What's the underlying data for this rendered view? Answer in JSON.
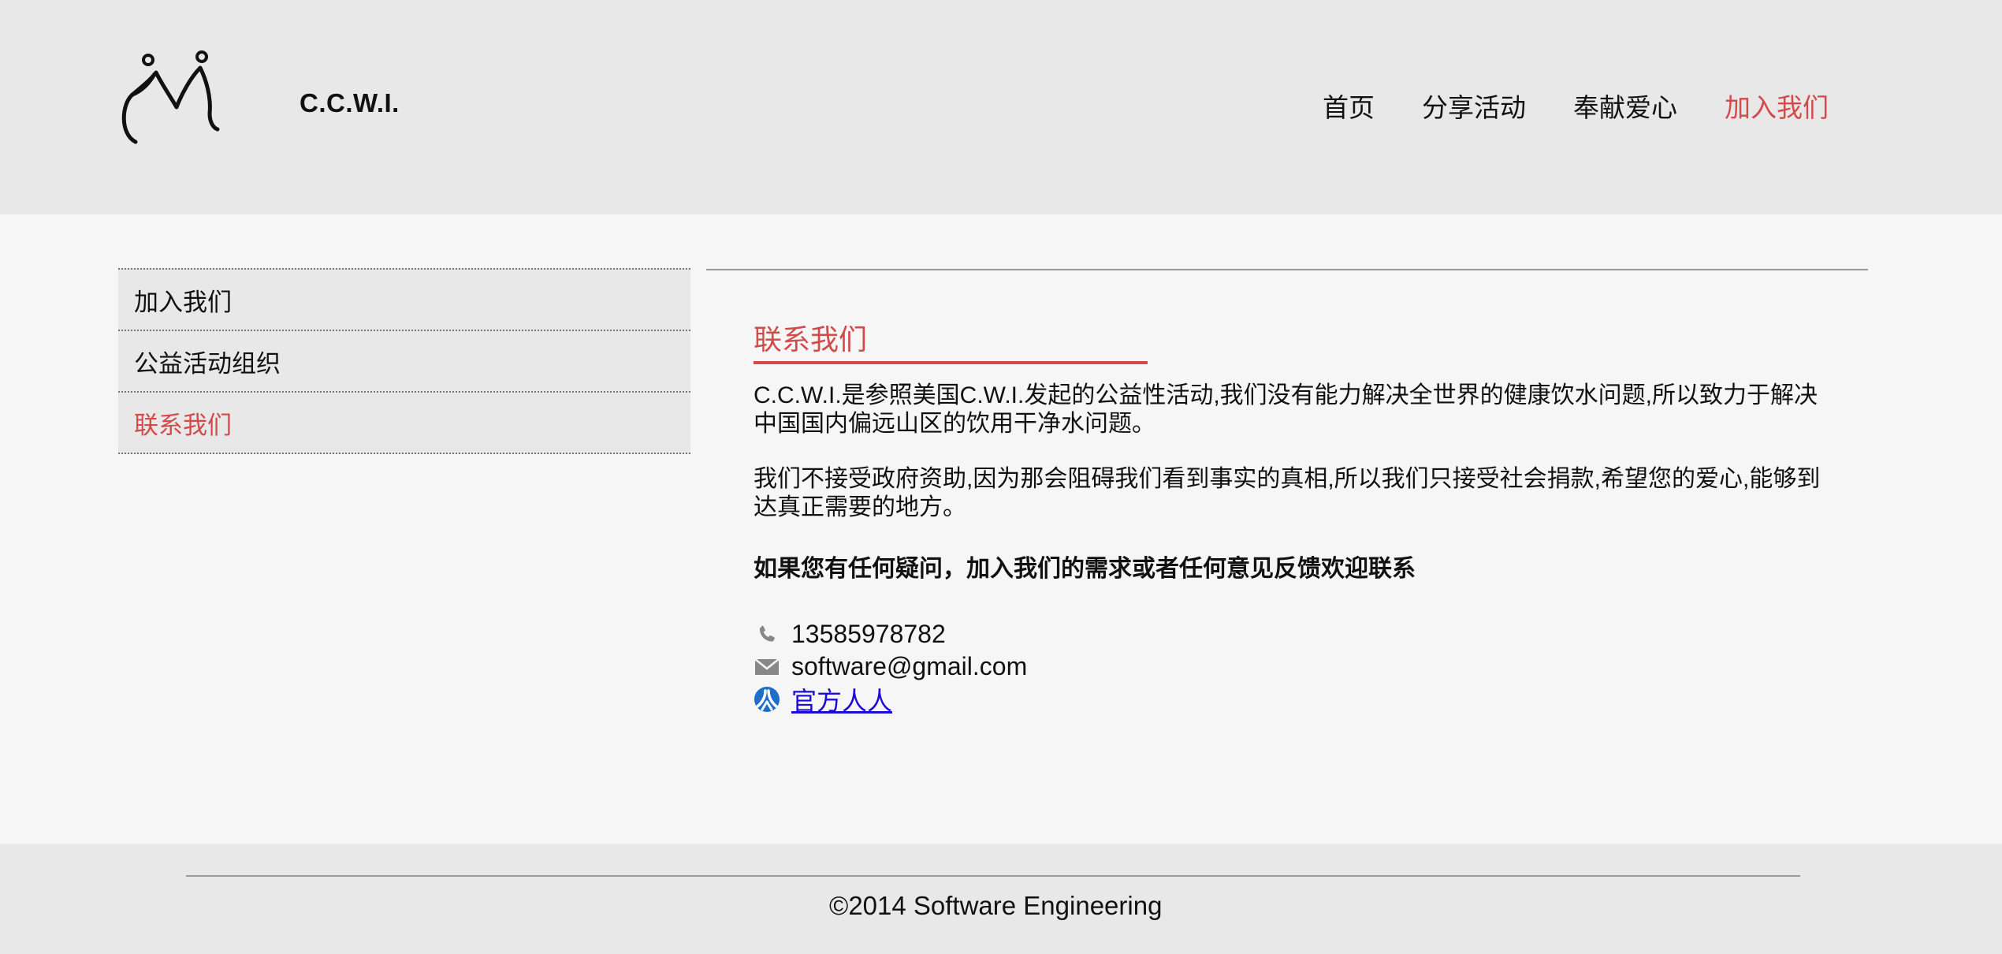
{
  "brand": {
    "name": "C.C.W.I."
  },
  "nav": {
    "items": [
      "首页",
      "分享活动",
      "奉献爱心",
      "加入我们"
    ],
    "active_color": "#d24a4a"
  },
  "sidebar": {
    "items": [
      "加入我们",
      "公益活动组织",
      "联系我们"
    ]
  },
  "main": {
    "title": "联系我们",
    "paragraphs": [
      "C.C.W.I.是参照美国C.W.I.发起的公益性活动,我们没有能力解决全世界的健康饮水问题,所以致力于解决中国国内偏远山区的饮用干净水问题。",
      "我们不接受政府资助,因为那会阻碍我们看到事实的真相,所以我们只接受社会捐款,希望您的爱心,能够到达真正需要的地方。"
    ],
    "note": "如果您有任何疑问，加入我们的需求或者任何意见反馈欢迎联系",
    "contacts": {
      "phone": "13585978782",
      "email": "software@gmail.com",
      "renren_label": "官方人人"
    }
  },
  "footer": {
    "copyright": "©2014 Software Engineering"
  }
}
